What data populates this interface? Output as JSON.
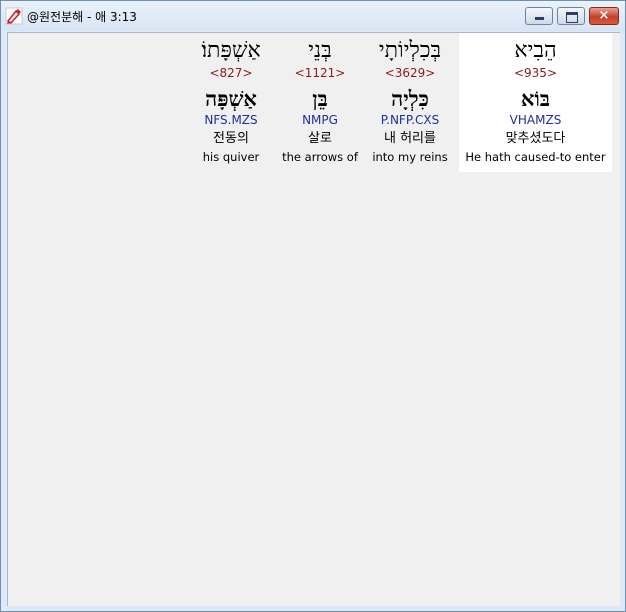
{
  "window": {
    "title": "@원전분해 - 애 3:13",
    "app_icon": "pen-icon",
    "buttons": {
      "minimize": "minimize-icon",
      "maximize": "maximize-icon",
      "close": "×"
    }
  },
  "words": [
    {
      "hebrew": "הֵבִיא",
      "strongs": "<935>",
      "lemma": "בּוֹא",
      "morph": "VHAMZS",
      "korean": "맞추셨도다",
      "english": "He hath caused-to enter",
      "selected": true
    },
    {
      "hebrew": "בְּכִלְיוֹתָי",
      "strongs": "<3629>",
      "lemma": "כִּלְיָה",
      "morph": "P.NFP.CXS",
      "korean": "내 허리를",
      "english": "into my reins",
      "selected": false
    },
    {
      "hebrew": "בְּנֵי",
      "strongs": "<1121>",
      "lemma": "בֵּן",
      "morph": "NMPG",
      "korean": "살로",
      "english": "the arrows of",
      "selected": false
    },
    {
      "hebrew": "אַשְׁפָּתוֹ׃",
      "strongs": "<827>",
      "lemma": "אַשְׁפָּה",
      "morph": "NFS.MZS",
      "korean": "전동의",
      "english": "his quiver",
      "selected": false
    }
  ]
}
